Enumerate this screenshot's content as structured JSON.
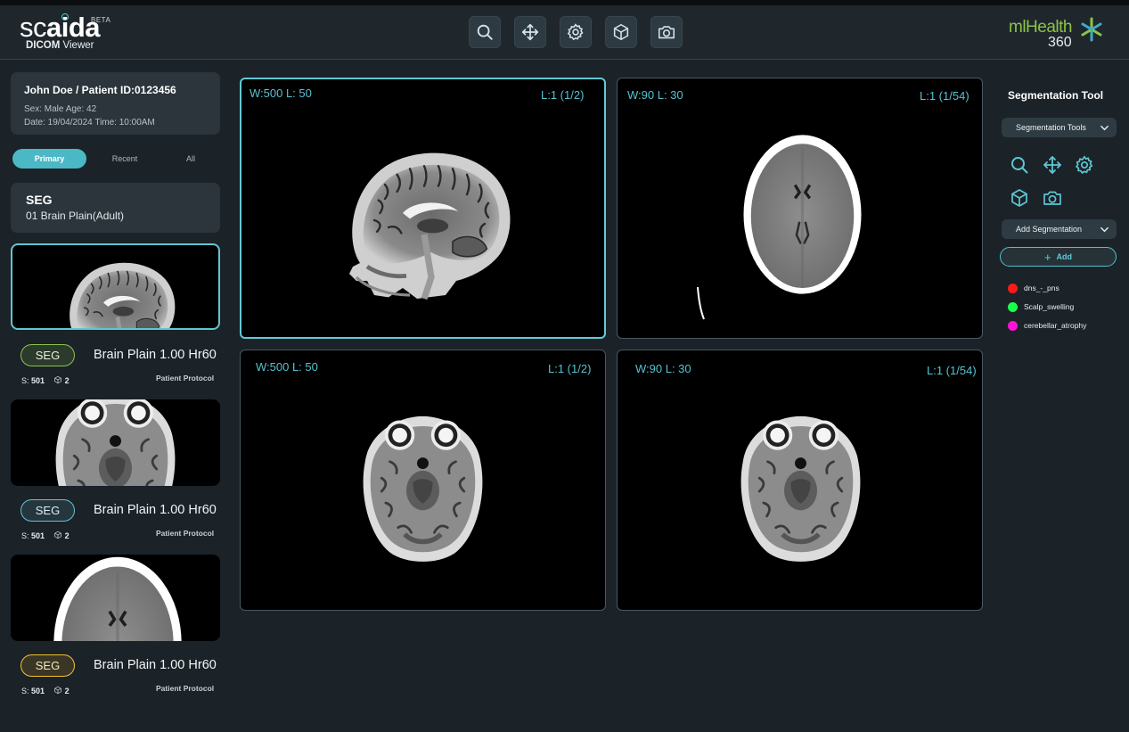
{
  "header": {
    "logo_main_light": "sc",
    "logo_main_bold": "aida",
    "logo_beta": "BETA",
    "logo_sub_bold": "DICOM",
    "logo_sub_rest": " Viewer",
    "brand_name": "mlHealth",
    "brand_number": "360",
    "toolbar": [
      {
        "icon": "search-icon"
      },
      {
        "icon": "move-icon"
      },
      {
        "icon": "gear-icon"
      },
      {
        "icon": "cube-icon"
      },
      {
        "icon": "camera-icon"
      }
    ]
  },
  "patient": {
    "title": "John Doe / Patient ID:0123456",
    "sex_age": "Sex: Male   Age: 42",
    "date_time": "Date: 19/04/2024   Time: 10:00AM"
  },
  "tabs": [
    {
      "label": "Primary",
      "active": true
    },
    {
      "label": "Recent",
      "active": false
    },
    {
      "label": "All",
      "active": false
    }
  ],
  "study": {
    "title": "SEG",
    "subtitle": "01 Brain Plain(Adult)"
  },
  "series": [
    {
      "badge": "SEG",
      "badge_color": "#8bc34a",
      "name": "Brain Plain 1.00 Hr60",
      "slices_label": "S:",
      "slices": "501",
      "count": "2",
      "protocol": "Patient Protocol",
      "thumb": "sagittal",
      "active": true
    },
    {
      "badge": "SEG",
      "badge_color": "#5fc6d3",
      "name": "Brain Plain 1.00 Hr60",
      "slices_label": "S:",
      "slices": "501",
      "count": "2",
      "protocol": "Patient Protocol",
      "thumb": "axial-mri",
      "active": false
    },
    {
      "badge": "SEG",
      "badge_color": "#f2c230",
      "name": "Brain Plain 1.00 Hr60",
      "slices_label": "S:",
      "slices": "501",
      "count": "2",
      "protocol": "Patient Protocol",
      "thumb": "axial-ct",
      "active": false
    }
  ],
  "viewports": [
    {
      "wl": "W:500 L: 50",
      "layer": "L:1 (1/2)",
      "image": "sagittal",
      "active": true
    },
    {
      "wl": "W:90 L: 30",
      "layer": "L:1 (1/54)",
      "image": "axial-ct",
      "active": false
    },
    {
      "wl": "W:500 L: 50",
      "layer": "L:1 (1/2)",
      "image": "axial-mri",
      "active": false
    },
    {
      "wl": "W:90 L: 30",
      "layer": "L:1 (1/54)",
      "image": "axial-mri",
      "active": false
    }
  ],
  "segmentation": {
    "title": "Segmentation Tool",
    "tools_dropdown": "Segmentation Tools",
    "tool_icons": [
      "search-icon",
      "move-icon",
      "gear-icon",
      "cube-icon",
      "camera-icon"
    ],
    "add_dropdown": "Add Segmentation",
    "add_button": "Add",
    "items": [
      {
        "label": "dns_-_pns",
        "color": "#ff1a1a"
      },
      {
        "label": "Scalp_swelling",
        "color": "#19ff4a"
      },
      {
        "label": "cerebellar_atrophy",
        "color": "#ff12d6"
      }
    ]
  },
  "colors": {
    "accent": "#5fc6d3",
    "background": "#1b2228",
    "panel": "#2b353b"
  }
}
